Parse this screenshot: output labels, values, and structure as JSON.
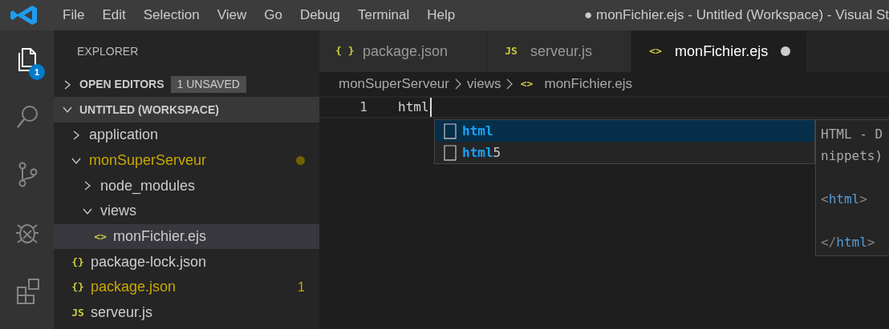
{
  "menu": [
    "File",
    "Edit",
    "Selection",
    "View",
    "Go",
    "Debug",
    "Terminal",
    "Help"
  ],
  "window": {
    "title": "● monFichier.ejs - Untitled (Workspace) - Visual St"
  },
  "activity_bar": [
    {
      "kind": "files",
      "selected": true,
      "badge": "1"
    },
    {
      "kind": "search",
      "selected": false
    },
    {
      "kind": "source-control",
      "selected": false
    },
    {
      "kind": "debug",
      "selected": false
    },
    {
      "kind": "extensions",
      "selected": false
    }
  ],
  "sidebar": {
    "title": "EXPLORER",
    "sections": [
      {
        "title": "OPEN EDITORS",
        "expanded": false,
        "badge": "1 UNSAVED"
      },
      {
        "title": "UNTITLED (WORKSPACE)",
        "expanded": true,
        "items": [
          {
            "label": "application",
            "kind": "folder",
            "expanded": false,
            "modified": false,
            "selected": false
          },
          {
            "label": "monSuperServeur",
            "kind": "folder",
            "expanded": true,
            "modified": true,
            "selected": false,
            "children": [
              {
                "label": "node_modules",
                "kind": "folder",
                "expanded": false,
                "modified": false,
                "selected": false
              },
              {
                "label": "views",
                "kind": "folder",
                "expanded": true,
                "modified": false,
                "selected": false,
                "children": [
                  {
                    "label": "monFichier.ejs",
                    "kind": "file",
                    "icon": "<>",
                    "modified": false,
                    "selected": true
                  }
                ]
              }
            ]
          },
          {
            "label": "package-lock.json",
            "kind": "file",
            "icon": "{}",
            "modified": false,
            "selected": false
          },
          {
            "label": "package.json",
            "kind": "file",
            "icon": "{}",
            "modified": true,
            "selected": false,
            "badge": "1"
          },
          {
            "label": "serveur.js",
            "kind": "file",
            "icon": "JS",
            "modified": false,
            "selected": false
          }
        ]
      }
    ]
  },
  "tabs": [
    {
      "label": "package.json",
      "icon": "{ }",
      "selected": false,
      "dirty": false
    },
    {
      "label": "serveur.js",
      "icon": "JS",
      "selected": false,
      "dirty": false
    },
    {
      "label": "monFichier.ejs",
      "icon": "<>",
      "selected": true,
      "dirty": true
    }
  ],
  "breadcrumb": [
    {
      "label": "monSuperServeur"
    },
    {
      "label": "views"
    },
    {
      "label": "monFichier.ejs",
      "icon": "<>"
    }
  ],
  "editor": {
    "lines": [
      {
        "number": "1",
        "text": "html"
      }
    ]
  },
  "suggestions": [
    {
      "matched": "html",
      "selected": true
    },
    {
      "matched": "html",
      "rest": "5",
      "selected": false
    }
  ],
  "suggestion_detail": [
    {
      "kind": "text",
      "text": "HTML - D"
    },
    {
      "kind": "text",
      "text": "nippets)"
    },
    {
      "kind": "blank"
    },
    {
      "kind": "tag",
      "open": "<",
      "name": "html",
      "close": ">"
    },
    {
      "kind": "blank"
    },
    {
      "kind": "tag",
      "open": "</",
      "name": "html",
      "close": ">"
    }
  ]
}
